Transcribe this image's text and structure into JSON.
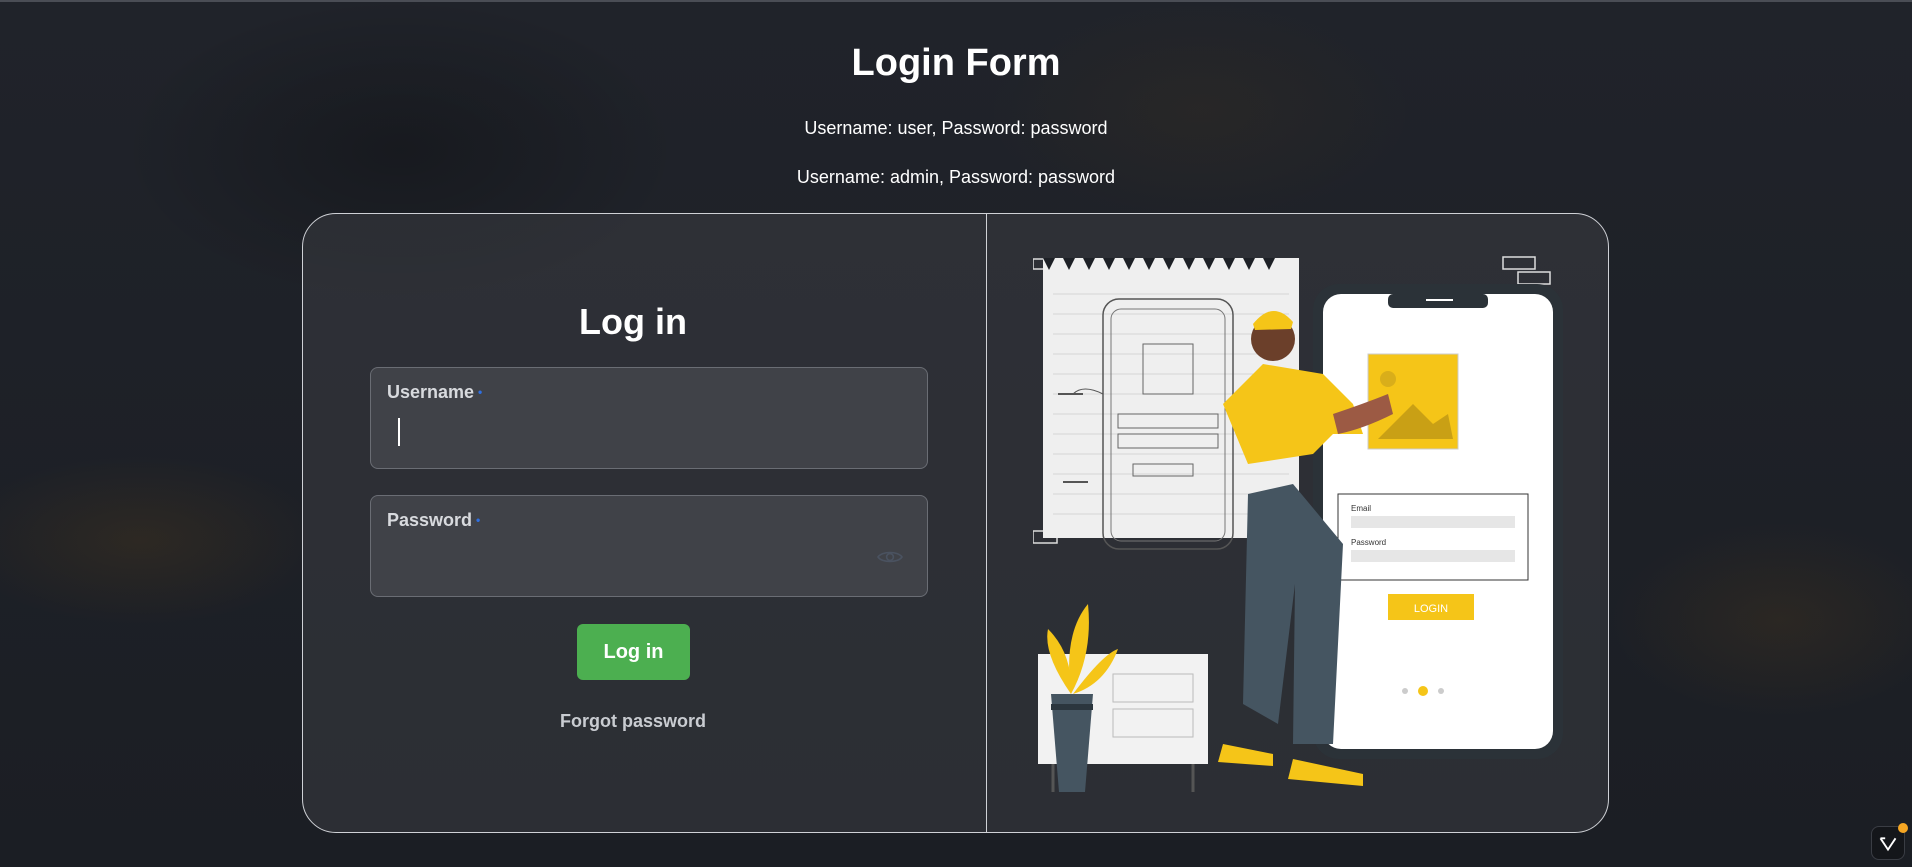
{
  "header": {
    "title": "Login Form",
    "credentials": [
      "Username: user, Password: password",
      "Username: admin, Password: password"
    ]
  },
  "form": {
    "title": "Log in",
    "username_label": "Username",
    "username_value": "",
    "password_label": "Password",
    "password_value": "",
    "required_marker": "•",
    "login_button": "Log in",
    "forgot_link": "Forgot password"
  },
  "illustration": {
    "phone_email_label": "Email",
    "phone_password_label": "Password",
    "phone_login_button": "LOGIN"
  },
  "colors": {
    "background": "#1d2026",
    "login_button": "#4caf50",
    "accent_yellow": "#f5c518",
    "required": "#2f6fe0"
  },
  "icons": [
    "eye-icon",
    "corner-app-icon"
  ]
}
